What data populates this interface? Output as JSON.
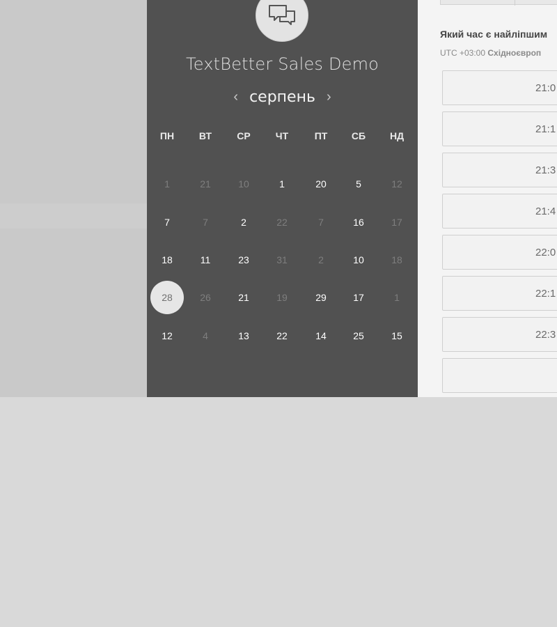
{
  "event": {
    "title": "TextBetter Sales Demo",
    "icon": "chat-bubbles-icon"
  },
  "calendar": {
    "month": "серпень",
    "prev_arrow": "‹",
    "next_arrow": "›",
    "weekdays": [
      "ПН",
      "ВТ",
      "СР",
      "ЧТ",
      "ПТ",
      "СБ",
      "НД"
    ],
    "weeks": [
      [
        {
          "t": "1",
          "muted": true
        },
        {
          "t": "21",
          "muted": true
        },
        {
          "t": "10",
          "muted": true
        },
        {
          "t": "1",
          "muted": false
        },
        {
          "t": "20",
          "muted": false
        },
        {
          "t": "5",
          "muted": false
        },
        {
          "t": "12",
          "muted": true
        }
      ],
      [
        {
          "t": "7",
          "muted": false
        },
        {
          "t": "7",
          "muted": true
        },
        {
          "t": "2",
          "muted": false
        },
        {
          "t": "22",
          "muted": true
        },
        {
          "t": "7",
          "muted": true
        },
        {
          "t": "16",
          "muted": false
        },
        {
          "t": "17",
          "muted": true
        }
      ],
      [
        {
          "t": "18",
          "muted": false
        },
        {
          "t": "11",
          "muted": false
        },
        {
          "t": "23",
          "muted": false
        },
        {
          "t": "31",
          "muted": true
        },
        {
          "t": "2",
          "muted": true
        },
        {
          "t": "10",
          "muted": false
        },
        {
          "t": "18",
          "muted": true
        }
      ],
      [
        {
          "t": "28",
          "muted": false,
          "selected": true
        },
        {
          "t": "26",
          "muted": true
        },
        {
          "t": "21",
          "muted": false
        },
        {
          "t": "19",
          "muted": true
        },
        {
          "t": "29",
          "muted": false
        },
        {
          "t": "17",
          "muted": false
        },
        {
          "t": "1",
          "muted": true
        }
      ],
      [
        {
          "t": "12",
          "muted": false
        },
        {
          "t": "4",
          "muted": true
        },
        {
          "t": "13",
          "muted": false
        },
        {
          "t": "22",
          "muted": false
        },
        {
          "t": "14",
          "muted": false
        },
        {
          "t": "25",
          "muted": false
        },
        {
          "t": "15",
          "muted": false
        }
      ]
    ]
  },
  "times": {
    "question": "Який час є найліпшим",
    "timezone_offset": "UTC +03:00",
    "timezone_name": "Східноєвроп",
    "slots": [
      "21:0",
      "21:1",
      "21:3",
      "21:4",
      "22:0",
      "22:1",
      "22:3"
    ]
  },
  "colors": {
    "panel": "#515151",
    "selected_day_bg": "#e6e6e6",
    "muted_day": "#7e7e7e"
  }
}
